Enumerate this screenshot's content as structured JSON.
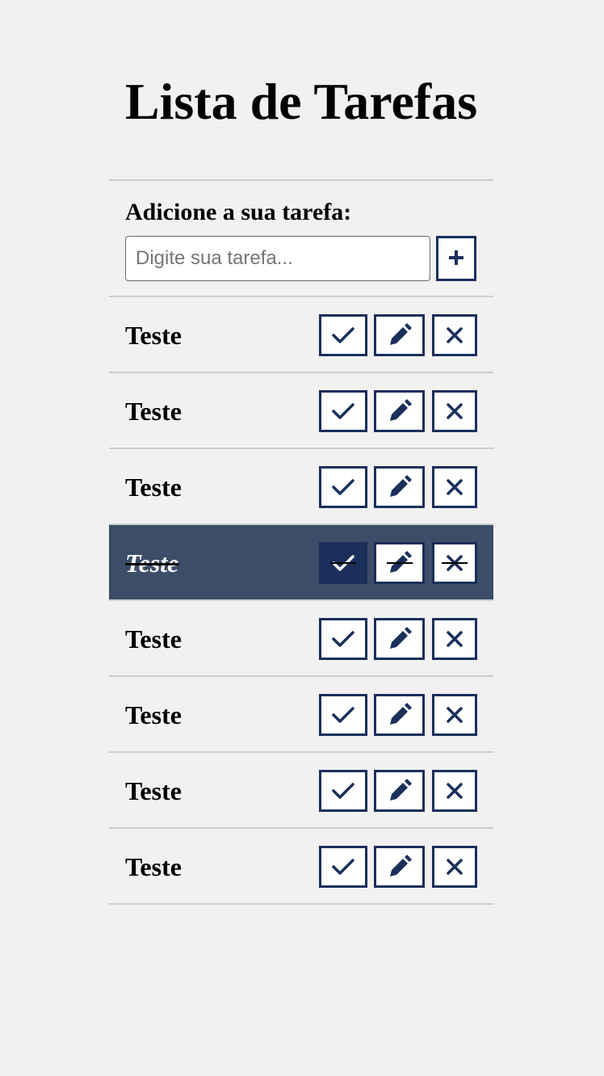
{
  "header": {
    "title": "Lista de Tarefas"
  },
  "form": {
    "label": "Adicione a sua tarefa:",
    "input_placeholder": "Digite sua tarefa...",
    "input_value": "",
    "add_icon": "plus-icon"
  },
  "todos": [
    {
      "title": "Teste",
      "done": false
    },
    {
      "title": "Teste",
      "done": false
    },
    {
      "title": "Teste",
      "done": false
    },
    {
      "title": "Teste",
      "done": true
    },
    {
      "title": "Teste",
      "done": false
    },
    {
      "title": "Teste",
      "done": false
    },
    {
      "title": "Teste",
      "done": false
    },
    {
      "title": "Teste",
      "done": false
    }
  ],
  "actions": {
    "finish_icon": "check-icon",
    "edit_icon": "pencil-icon",
    "remove_icon": "close-icon"
  },
  "colors": {
    "background": "#f1f1f1",
    "accent": "#1b2f5b",
    "done_row": "#3b4d68",
    "divider": "#cfcfcf"
  }
}
